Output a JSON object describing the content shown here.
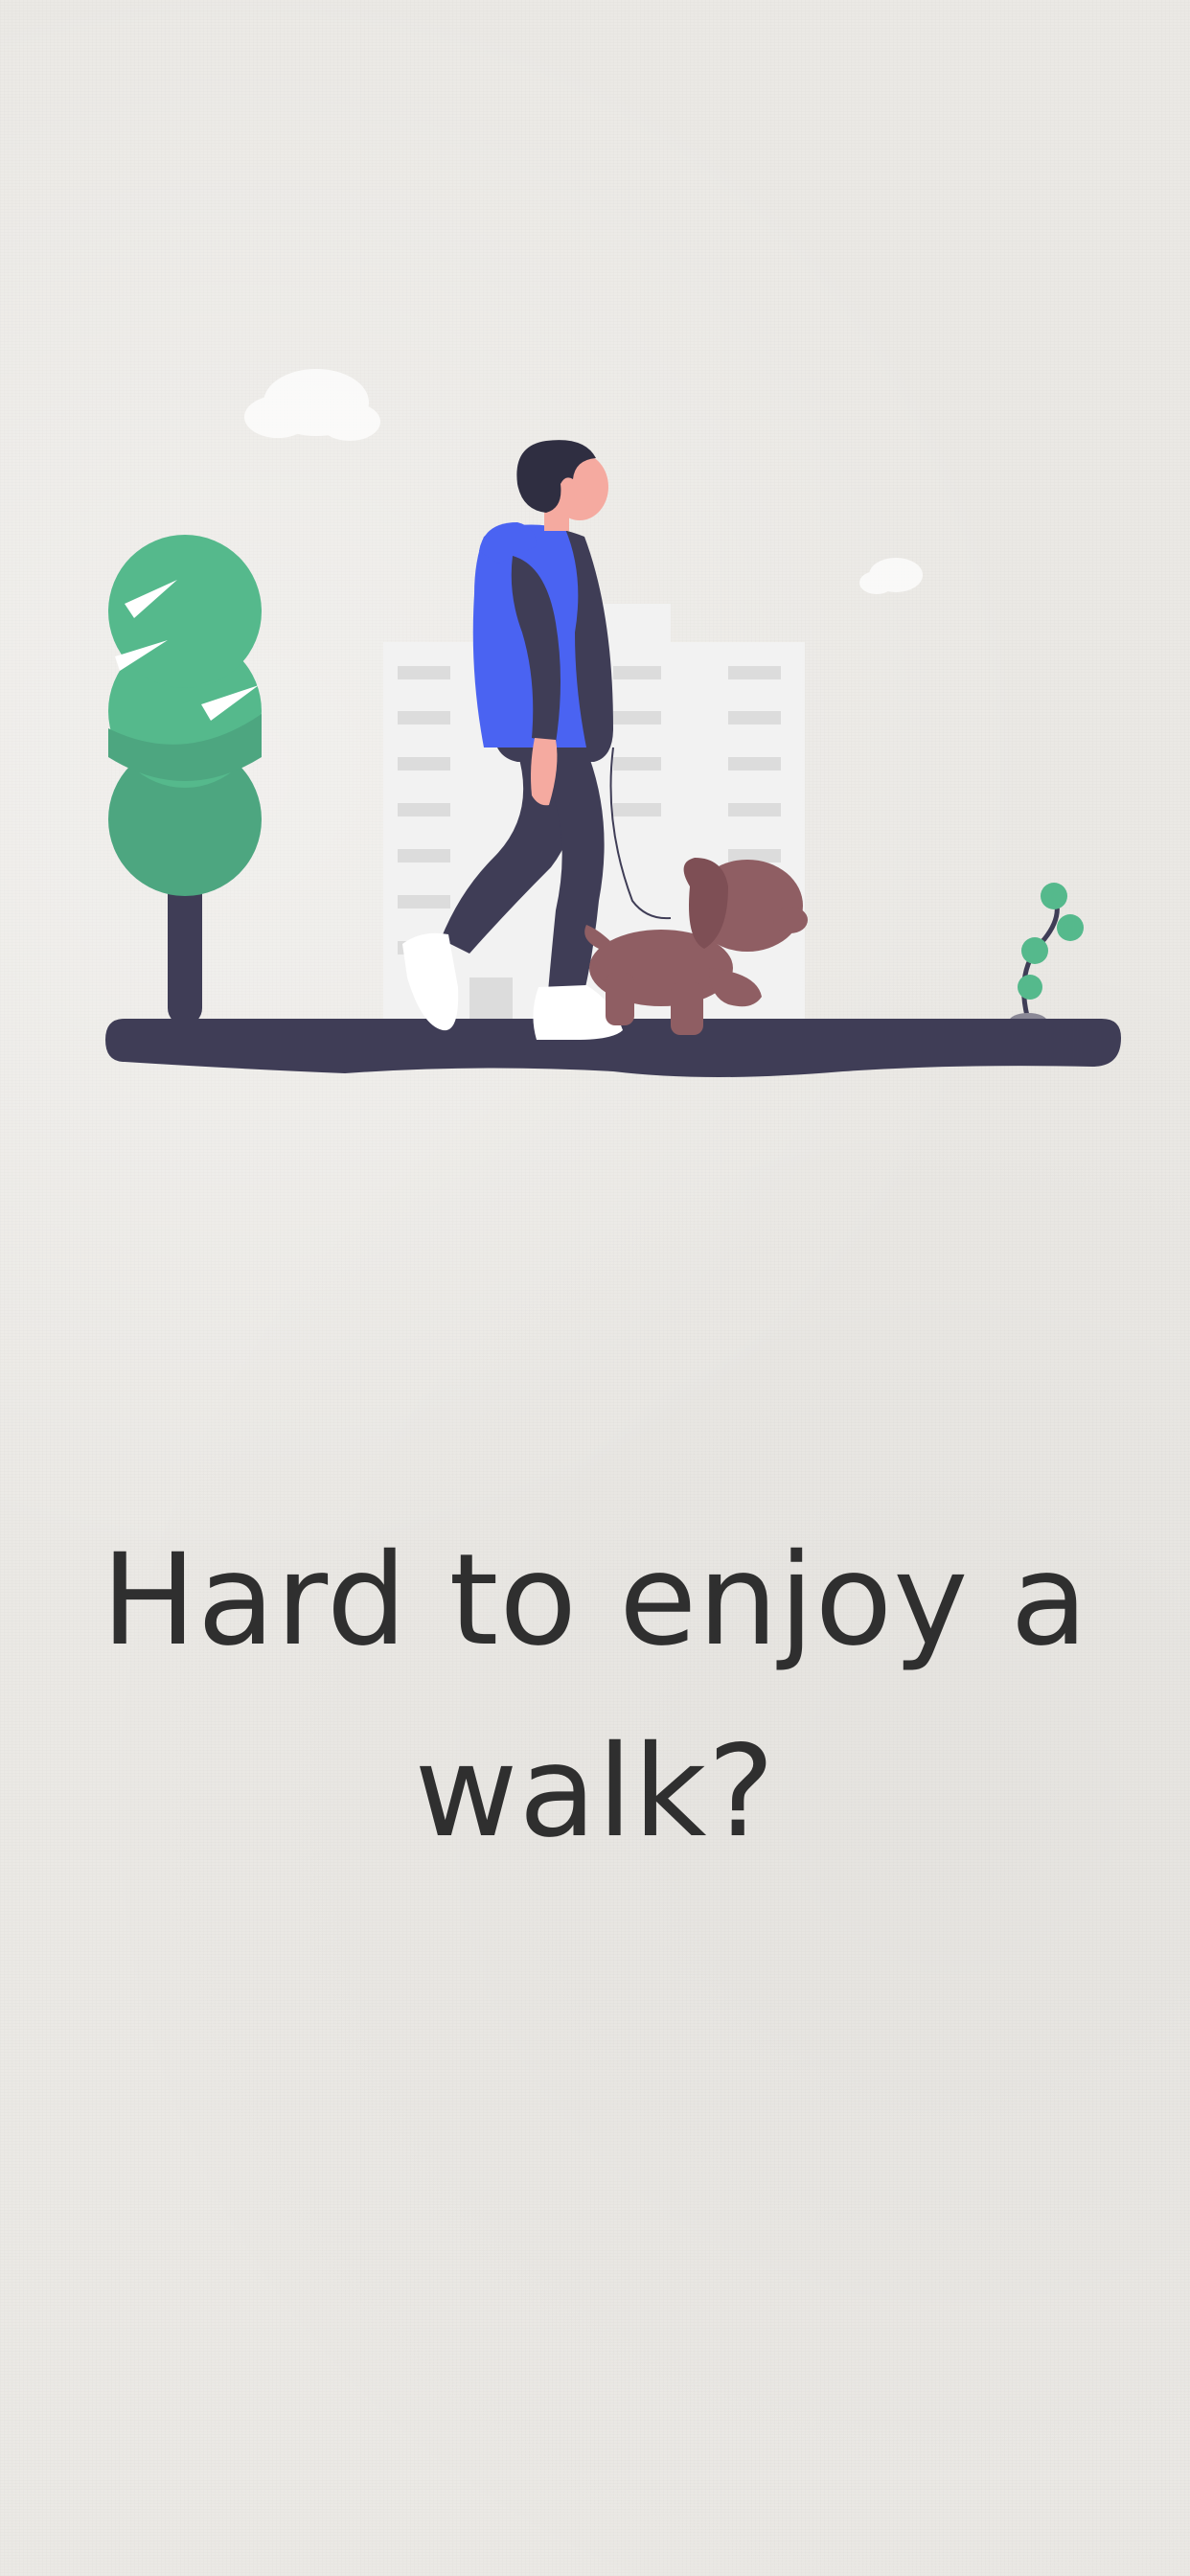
{
  "onboarding": {
    "headline": "Hard to enjoy a walk?",
    "illustration": {
      "icon": "person-walking-dog-icon",
      "colors": {
        "jacket": "#4a63f2",
        "dark": "#3f3d56",
        "tree": "#55b98c",
        "tree_shade": "#4da680",
        "dog": "#8f5e63",
        "skin": "#f5aaa0",
        "building": "#f2f2f2",
        "cloud": "#ffffff"
      }
    }
  }
}
